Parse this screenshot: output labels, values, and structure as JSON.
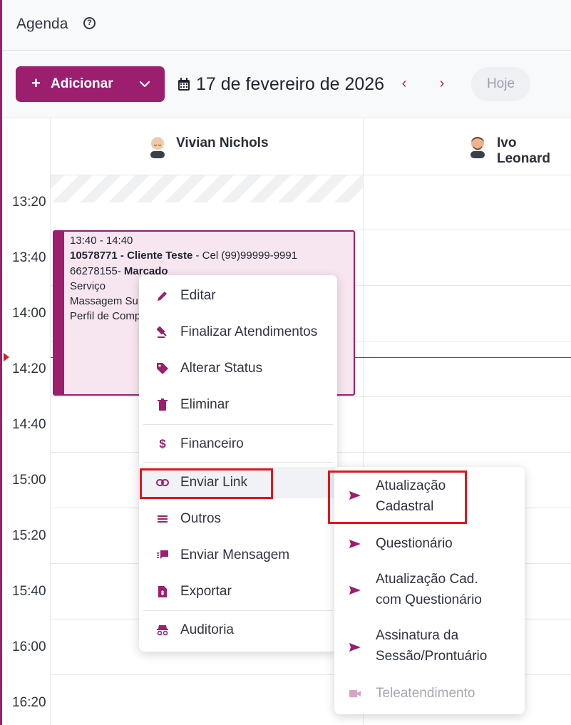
{
  "header": {
    "title": "Agenda"
  },
  "toolbar": {
    "add_label": "Adicionar",
    "date": "17 de fevereiro de 2026",
    "prev": "‹",
    "next": "›",
    "today": "Hoje"
  },
  "professionals": [
    "Vivian Nichols",
    "Ivo Leonard"
  ],
  "times": [
    "13:20",
    "13:40",
    "14:00",
    "14:20",
    "14:40",
    "15:00",
    "15:20",
    "15:40",
    "16:00",
    "16:20"
  ],
  "appointment": {
    "time_range": "13:40 - 14:40",
    "client": "10578771 - Cliente Teste",
    "phone": " - Cel (99)99999-9991",
    "code": "66278155- ",
    "status": "Marcado",
    "line_service": "Serviço",
    "line_service_name": "Massagem Su",
    "line_profile": "Perfil de Comp"
  },
  "context_menu": {
    "items": [
      {
        "label": "Editar",
        "icon": "pencil-icon"
      },
      {
        "label": "Finalizar Atendimentos",
        "icon": "gavel-icon"
      },
      {
        "label": "Alterar Status",
        "icon": "tag-icon"
      },
      {
        "label": "Eliminar",
        "icon": "trash-icon"
      },
      {
        "label": "Financeiro",
        "icon": "dollar-icon"
      },
      {
        "label": "Enviar Link",
        "icon": "link-icon"
      },
      {
        "label": "Outros",
        "icon": "menu-lines-icon"
      },
      {
        "label": "Enviar Mensagem",
        "icon": "message-icon"
      },
      {
        "label": "Exportar",
        "icon": "export-file-icon"
      },
      {
        "label": "Auditoria",
        "icon": "incognito-icon"
      }
    ]
  },
  "submenu": {
    "items": [
      {
        "label": "Atualização\nCadastral",
        "icon": "send-icon"
      },
      {
        "label": "Questionário",
        "icon": "send-icon"
      },
      {
        "label": "Atualização Cad.\ncom Questionário",
        "icon": "send-icon"
      },
      {
        "label": "Assinatura da\nSessão/Prontuário",
        "icon": "send-icon"
      },
      {
        "label": "Teleatendimento",
        "icon": "video-icon",
        "disabled": true
      }
    ]
  },
  "colors": {
    "accent": "#9c1e6f",
    "highlight": "#e3141c",
    "now_line": "#d21f2a",
    "event_bg": "#f7e6ef"
  }
}
